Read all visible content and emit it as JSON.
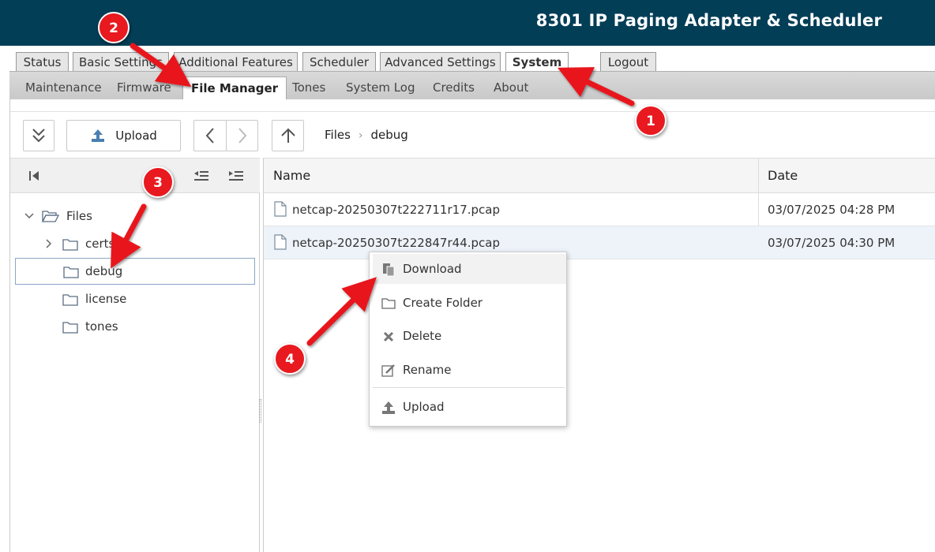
{
  "app": {
    "title": "8301 IP Paging Adapter & Scheduler"
  },
  "main_tabs": [
    {
      "label": "Status"
    },
    {
      "label": "Basic Settings"
    },
    {
      "label": "Additional Features"
    },
    {
      "label": "Scheduler"
    },
    {
      "label": "Advanced Settings"
    },
    {
      "label": "System",
      "active": true
    },
    {
      "label": "Logout"
    }
  ],
  "sub_tabs": [
    {
      "label": "Maintenance"
    },
    {
      "label": "Firmware"
    },
    {
      "label": "File Manager",
      "active": true
    },
    {
      "label": "Tones"
    },
    {
      "label": "System Log"
    },
    {
      "label": "Credits"
    },
    {
      "label": "About"
    }
  ],
  "toolbar": {
    "upload_label": "Upload"
  },
  "breadcrumb": [
    "Files",
    "debug"
  ],
  "tree": {
    "root": "Files",
    "folders": [
      {
        "label": "certs",
        "expandable": true
      },
      {
        "label": "debug",
        "selected": true
      },
      {
        "label": "license"
      },
      {
        "label": "tones"
      }
    ]
  },
  "file_list": {
    "columns": [
      "Name",
      "Date"
    ],
    "rows": [
      {
        "name": "netcap-20250307t222711r17.pcap",
        "date": "03/07/2025 04:28 PM"
      },
      {
        "name": "netcap-20250307t222847r44.pcap",
        "date": "03/07/2025 04:30 PM"
      }
    ]
  },
  "context_menu": {
    "items": [
      {
        "label": "Download",
        "icon": "download-icon",
        "highlighted": true
      },
      {
        "label": "Create Folder",
        "icon": "folder-icon"
      },
      {
        "label": "Delete",
        "icon": "x-icon"
      },
      {
        "label": "Rename",
        "icon": "edit-icon"
      },
      {
        "label": "Upload",
        "icon": "upload-icon"
      }
    ]
  },
  "annotations": [
    {
      "number": "1"
    },
    {
      "number": "2"
    },
    {
      "number": "3"
    },
    {
      "number": "4"
    }
  ],
  "colors": {
    "header_bg": "#033e57",
    "annotation_red": "#e8191f"
  }
}
